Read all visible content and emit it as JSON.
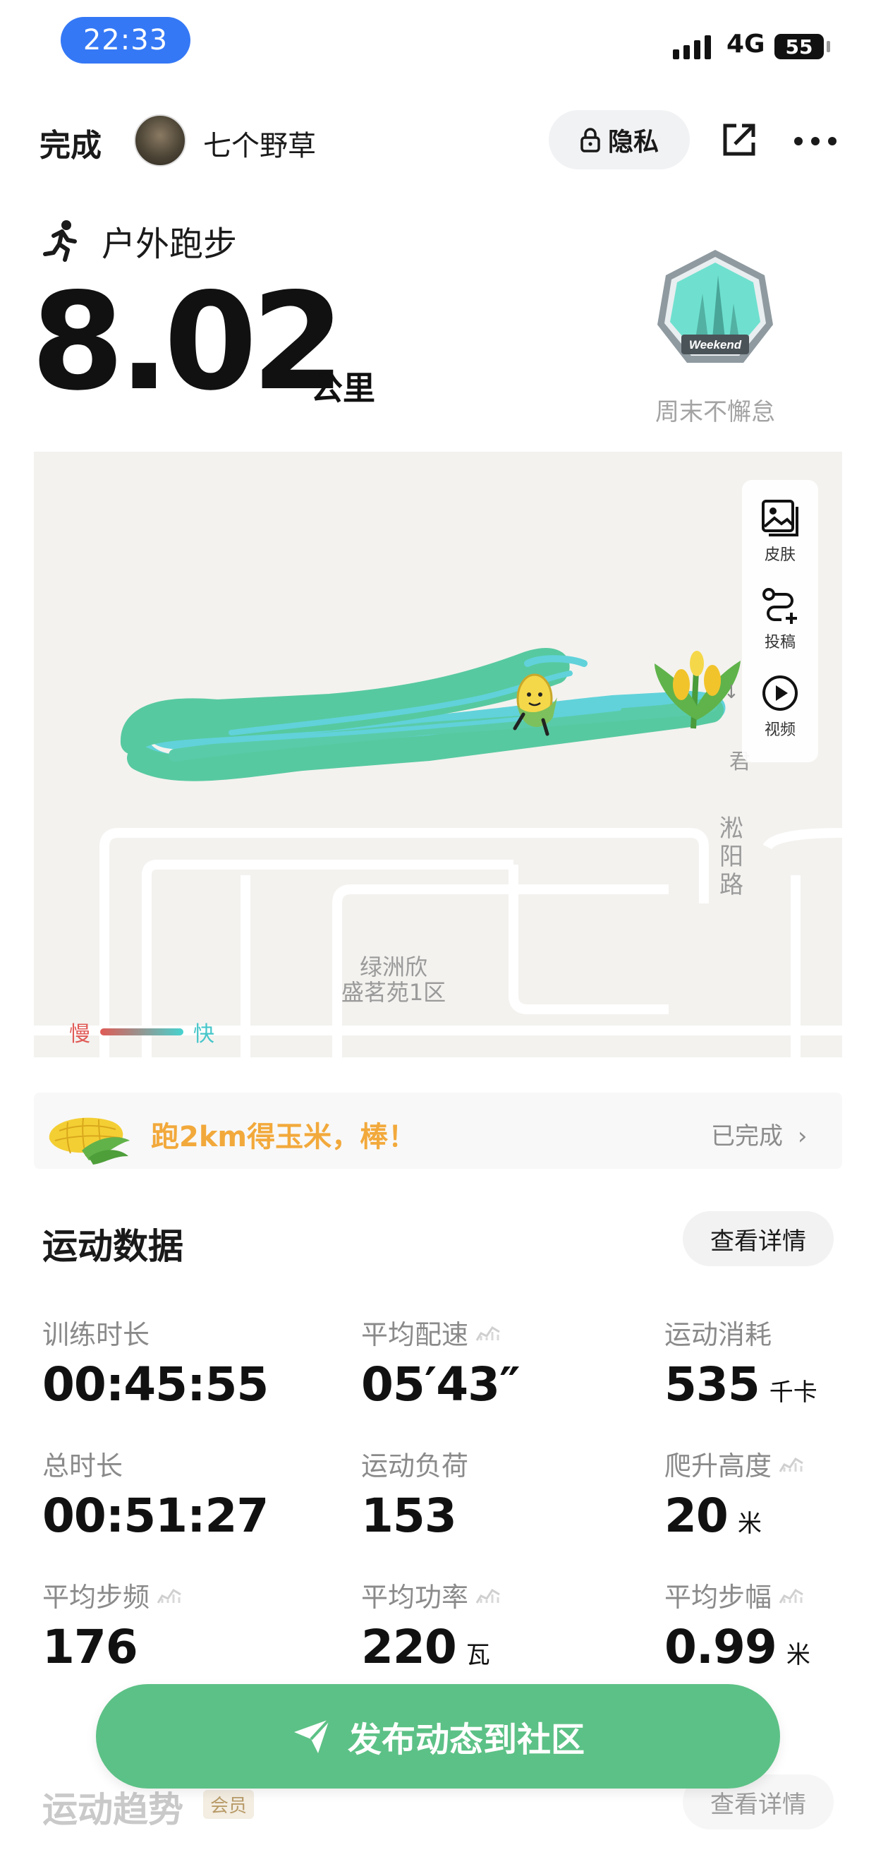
{
  "status_bar": {
    "time": "22:33",
    "network": "4G",
    "battery": "55"
  },
  "header": {
    "done_label": "完成",
    "username": "七个野草",
    "privacy_label": "隐私"
  },
  "activity": {
    "type": "户外跑步",
    "distance": "8.02",
    "distance_unit": "公里"
  },
  "badge": {
    "emblem_text": "Weekend",
    "name": "周末不懈怠"
  },
  "map": {
    "area_label": "绿洲欣\n盛茗苑1区",
    "road_label": "淞阳路",
    "partial_label": "君",
    "legend_slow": "慢",
    "legend_fast": "快",
    "tools": [
      {
        "label": "皮肤",
        "icon": "image-icon"
      },
      {
        "label": "投稿",
        "icon": "route-add-icon"
      },
      {
        "label": "视频",
        "icon": "play-icon"
      }
    ],
    "colors": {
      "route_main": "#4fc79c",
      "route_fast": "#5ad1d9",
      "slow": "#e05a55"
    }
  },
  "mission": {
    "text": "跑2km得玉米，棒！",
    "status": "已完成"
  },
  "stats": {
    "title": "运动数据",
    "detail_label": "查看详情",
    "items": [
      {
        "label": "训练时长",
        "value": "00:45:55",
        "unit": ""
      },
      {
        "label": "平均配速",
        "value": "05′43″",
        "unit": ""
      },
      {
        "label": "运动消耗",
        "value": "535",
        "unit": "千卡"
      },
      {
        "label": "总时长",
        "value": "00:51:27",
        "unit": ""
      },
      {
        "label": "运动负荷",
        "value": "153",
        "unit": ""
      },
      {
        "label": "爬升高度",
        "value": "20",
        "unit": "米"
      },
      {
        "label": "平均步频",
        "value": "176",
        "unit": ""
      },
      {
        "label": "平均功率",
        "value": "220",
        "unit": "瓦"
      },
      {
        "label": "平均步幅",
        "value": "0.99",
        "unit": "米"
      }
    ]
  },
  "publish_label": "发布动态到社区",
  "trend": {
    "title": "运动趋势",
    "member_tag": "会员",
    "detail_label": "查看详情"
  },
  "accent_color": "#5cc186"
}
